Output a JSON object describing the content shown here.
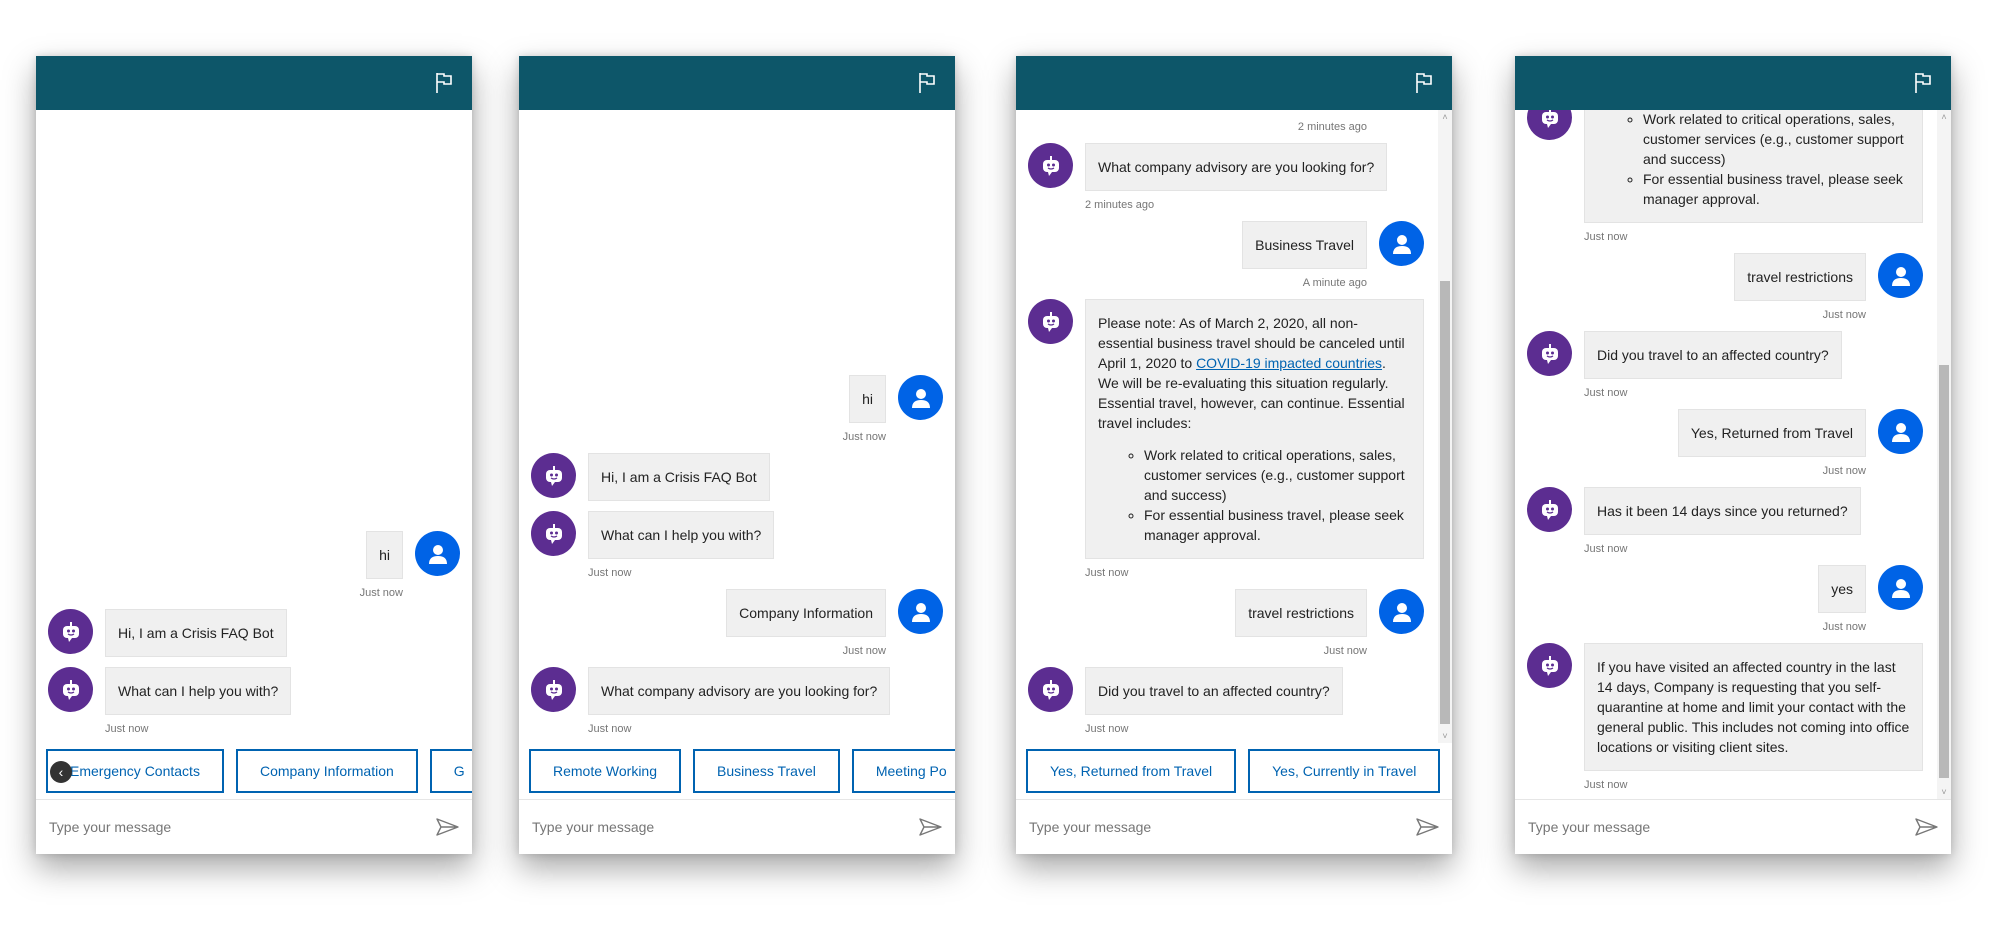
{
  "colors": {
    "header": "#0d5669",
    "bot_avatar": "#5c2d91",
    "user_avatar": "#0063e6",
    "action": "#0063b1",
    "bubble": "#f0f0f0"
  },
  "icons": {
    "header": "flag-icon",
    "send": "send-icon",
    "bot": "bot-avatar-icon",
    "user": "user-avatar-icon"
  },
  "input_placeholder": "Type your message",
  "panels": [
    {
      "scroll": null,
      "messages": [
        {
          "role": "user",
          "text": "hi",
          "ts": "Just now"
        },
        {
          "role": "bot",
          "text": "Hi, I am a Crisis FAQ Bot"
        },
        {
          "role": "bot",
          "text": "What can I help you with?",
          "ts": "Just now"
        }
      ],
      "actions": [
        "Emergency Contacts",
        "Company Information",
        "G"
      ],
      "scroll_left": true
    },
    {
      "scroll": null,
      "messages": [
        {
          "role": "user",
          "text": "hi",
          "ts": "Just now"
        },
        {
          "role": "bot",
          "text": "Hi, I am a Crisis FAQ Bot"
        },
        {
          "role": "bot",
          "text": "What can I help you with?",
          "ts": "Just now"
        },
        {
          "role": "user",
          "text": "Company Information",
          "ts": "Just now"
        },
        {
          "role": "bot",
          "text": "What company advisory are you looking for?",
          "ts": "Just now"
        }
      ],
      "actions": [
        "Remote Working",
        "Business Travel",
        "Meeting Po"
      ]
    },
    {
      "scroll": {
        "thumb_start": 0.27,
        "thumb_end": 0.97
      },
      "top_ts": "2 minutes ago",
      "messages": [
        {
          "role": "bot",
          "text": "What company advisory are you looking for?",
          "ts": "2 minutes ago"
        },
        {
          "role": "user",
          "text": "Business Travel",
          "ts": "A minute ago"
        },
        {
          "role": "bot",
          "text": "Please note:  As of March 2, 2020,  all non-essential business travel should be canceled until April 1, 2020 to ",
          "link": "COVID-19 impacted countries",
          "after": ".",
          "para2": "We will be re-evaluating this situation regularly. Essential travel, however, can continue. Essential travel includes:",
          "bullets": [
            "Work related to critical operations, sales, customer services (e.g., customer support and success)",
            "For essential business travel, please seek manager approval."
          ],
          "ts": "Just now"
        },
        {
          "role": "user",
          "text": "travel restrictions",
          "ts": "Just now"
        },
        {
          "role": "bot",
          "text": "Did you travel to an affected country?",
          "ts": "Just now"
        }
      ],
      "actions": [
        "Yes, Returned from Travel",
        "Yes, Currently in Travel"
      ]
    },
    {
      "scroll": {
        "thumb_start": 0.37,
        "thumb_end": 0.97
      },
      "messages": [
        {
          "role": "bot",
          "bullets": [
            "Work related to critical operations, sales, customer services (e.g., customer support and success)",
            "For essential business travel, please seek manager approval."
          ],
          "ts": "Just now"
        },
        {
          "role": "user",
          "text": "travel restrictions",
          "ts": "Just now"
        },
        {
          "role": "bot",
          "text": "Did you travel to an affected country?",
          "ts": "Just now"
        },
        {
          "role": "user",
          "text": "Yes, Returned from Travel",
          "ts": "Just now"
        },
        {
          "role": "bot",
          "text": "Has it been 14 days since you returned?",
          "ts": "Just now"
        },
        {
          "role": "user",
          "text": "yes",
          "ts": "Just now"
        },
        {
          "role": "bot",
          "text": "If you have visited an affected country in the last 14 days, Company is requesting that you self-quarantine at home and limit your contact with the general public. This includes not coming into office locations or visiting client sites.",
          "ts": "Just now"
        }
      ],
      "actions": []
    }
  ]
}
